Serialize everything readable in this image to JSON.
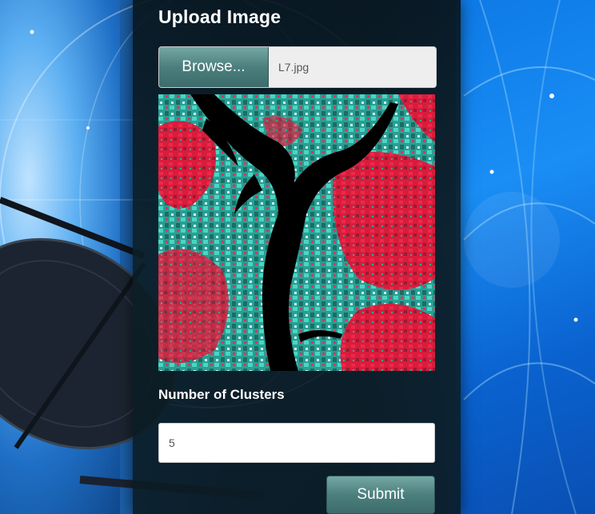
{
  "upload": {
    "title": "Upload Image",
    "browse_label": "Browse...",
    "file_name": "L7.jpg"
  },
  "clusters": {
    "label": "Number of Clusters",
    "value": "5"
  },
  "submit_label": "Submit",
  "colors": {
    "button_gradient_top": "#75a8a5",
    "button_gradient_bottom": "#3c6c6b",
    "panel": "#0c1e26",
    "preview_vegetation": "#e8203c",
    "preview_urban": "#2ab7a6",
    "preview_water": "#000000"
  },
  "icons": {
    "background": "satellite-dish-globe"
  }
}
